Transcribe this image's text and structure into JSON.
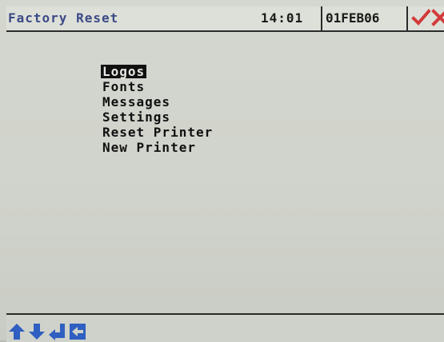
{
  "header": {
    "title": "Factory Reset",
    "time": "14:01",
    "date": "01FEB06",
    "ok_icon": "check-icon",
    "cancel_icon": "cross-icon"
  },
  "menu": {
    "items": [
      {
        "label": "Logos",
        "selected": true
      },
      {
        "label": "Fonts",
        "selected": false
      },
      {
        "label": "Messages",
        "selected": false
      },
      {
        "label": "Settings",
        "selected": false
      },
      {
        "label": "Reset Printer",
        "selected": false
      },
      {
        "label": "New Printer",
        "selected": false
      }
    ]
  },
  "footer": {
    "icons": [
      "arrow-up-icon",
      "arrow-down-icon",
      "enter-icon",
      "back-icon"
    ]
  },
  "colors": {
    "accent_title": "#3b4a86",
    "ok_red": "#d23a3a",
    "nav_blue": "#2f5fc0"
  }
}
